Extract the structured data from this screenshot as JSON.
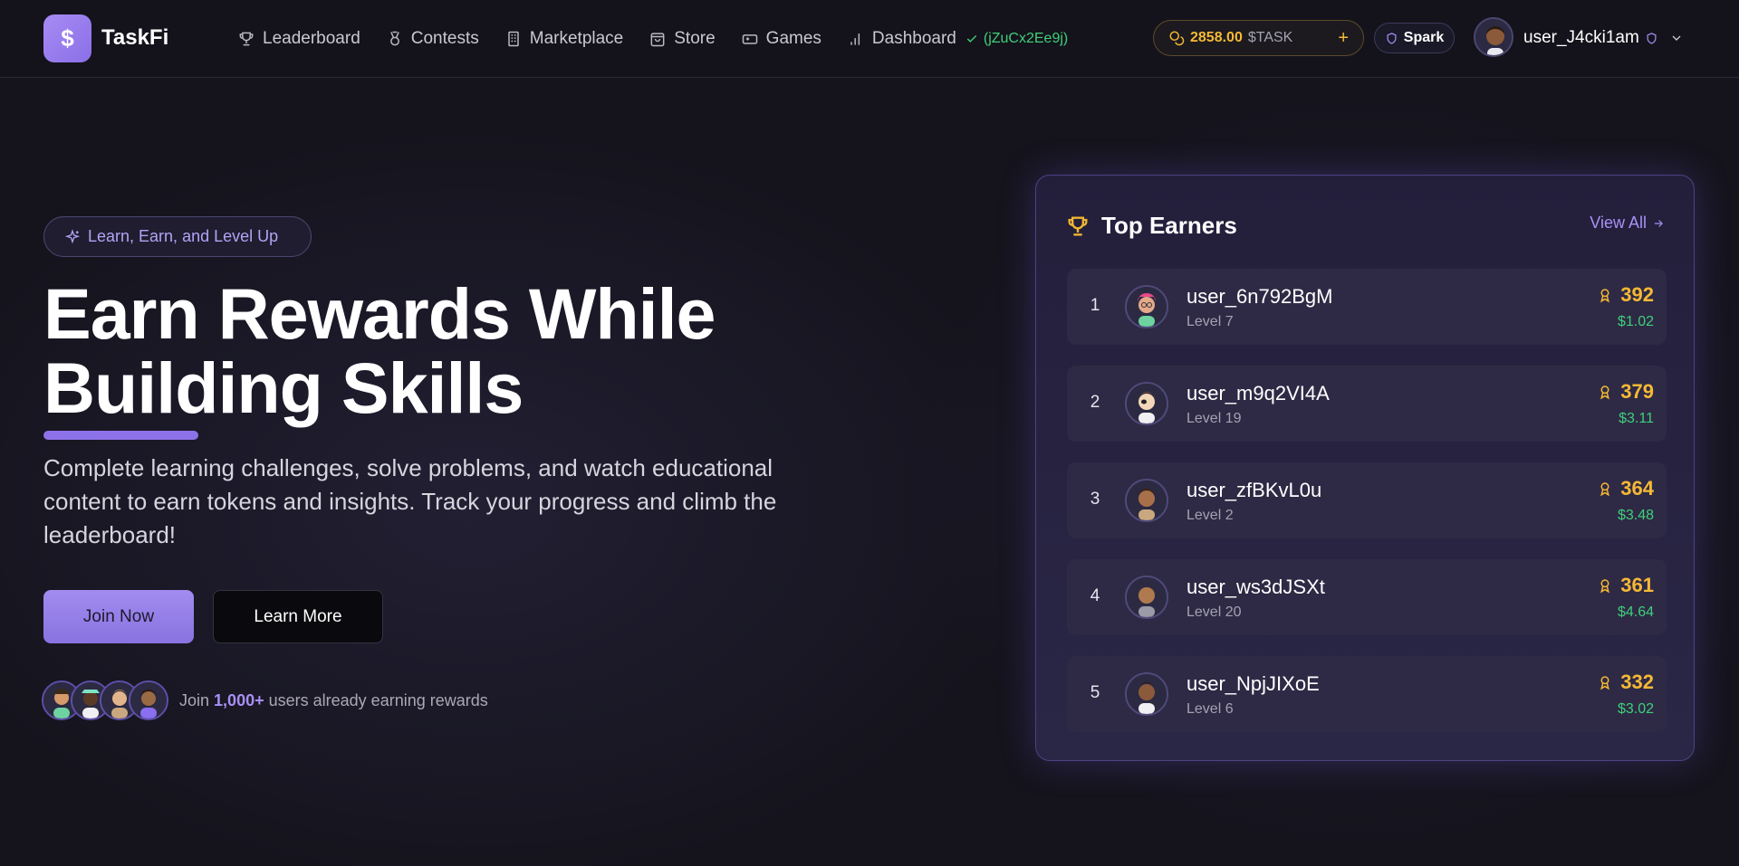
{
  "brand": {
    "logo_symbol": "$",
    "name": "TaskFi"
  },
  "nav": {
    "links": [
      {
        "label": "Leaderboard",
        "icon": "trophy-icon"
      },
      {
        "label": "Contests",
        "icon": "medal-icon"
      },
      {
        "label": "Marketplace",
        "icon": "building-icon"
      },
      {
        "label": "Store",
        "icon": "shopping-bag-icon"
      },
      {
        "label": "Games",
        "icon": "gamepad-icon"
      },
      {
        "label": "Dashboard",
        "icon": "bar-chart-icon"
      }
    ],
    "wallet_verified": "(jZuCx2Ee9j)"
  },
  "balance": {
    "amount": "2858.00",
    "unit": "$TASK",
    "add": "+"
  },
  "tier": {
    "label": "Spark"
  },
  "user": {
    "name": "user_J4cki1am"
  },
  "hero": {
    "pill": "Learn, Earn, and Level Up",
    "title_line1": "Earn Rewards While",
    "title_line2": "Building Skills",
    "description": "Complete learning challenges, solve problems, and watch educational content to earn tokens and insights. Track your progress and climb the leaderboard!",
    "join_label": "Join Now",
    "learn_label": "Learn More",
    "social_prefix": "Join",
    "social_count": "1,000+",
    "social_suffix": "users already earning rewards"
  },
  "top_earners": {
    "title": "Top Earners",
    "view_all": "View All",
    "rows": [
      {
        "rank": "1",
        "name": "user_6n792BgM",
        "level": "Level 7",
        "points": "392",
        "usd": "$1.02"
      },
      {
        "rank": "2",
        "name": "user_m9q2VI4A",
        "level": "Level 19",
        "points": "379",
        "usd": "$3.11"
      },
      {
        "rank": "3",
        "name": "user_zfBKvL0u",
        "level": "Level 2",
        "points": "364",
        "usd": "$3.48"
      },
      {
        "rank": "4",
        "name": "user_ws3dJSXt",
        "level": "Level 20",
        "points": "361",
        "usd": "$4.64"
      },
      {
        "rank": "5",
        "name": "user_NpjJIXoE",
        "level": "Level 6",
        "points": "332",
        "usd": "$3.02"
      }
    ]
  },
  "colors": {
    "accent": "#8c72e8",
    "gold": "#f6b935",
    "green": "#3fcf7a",
    "background": "#15141d"
  }
}
